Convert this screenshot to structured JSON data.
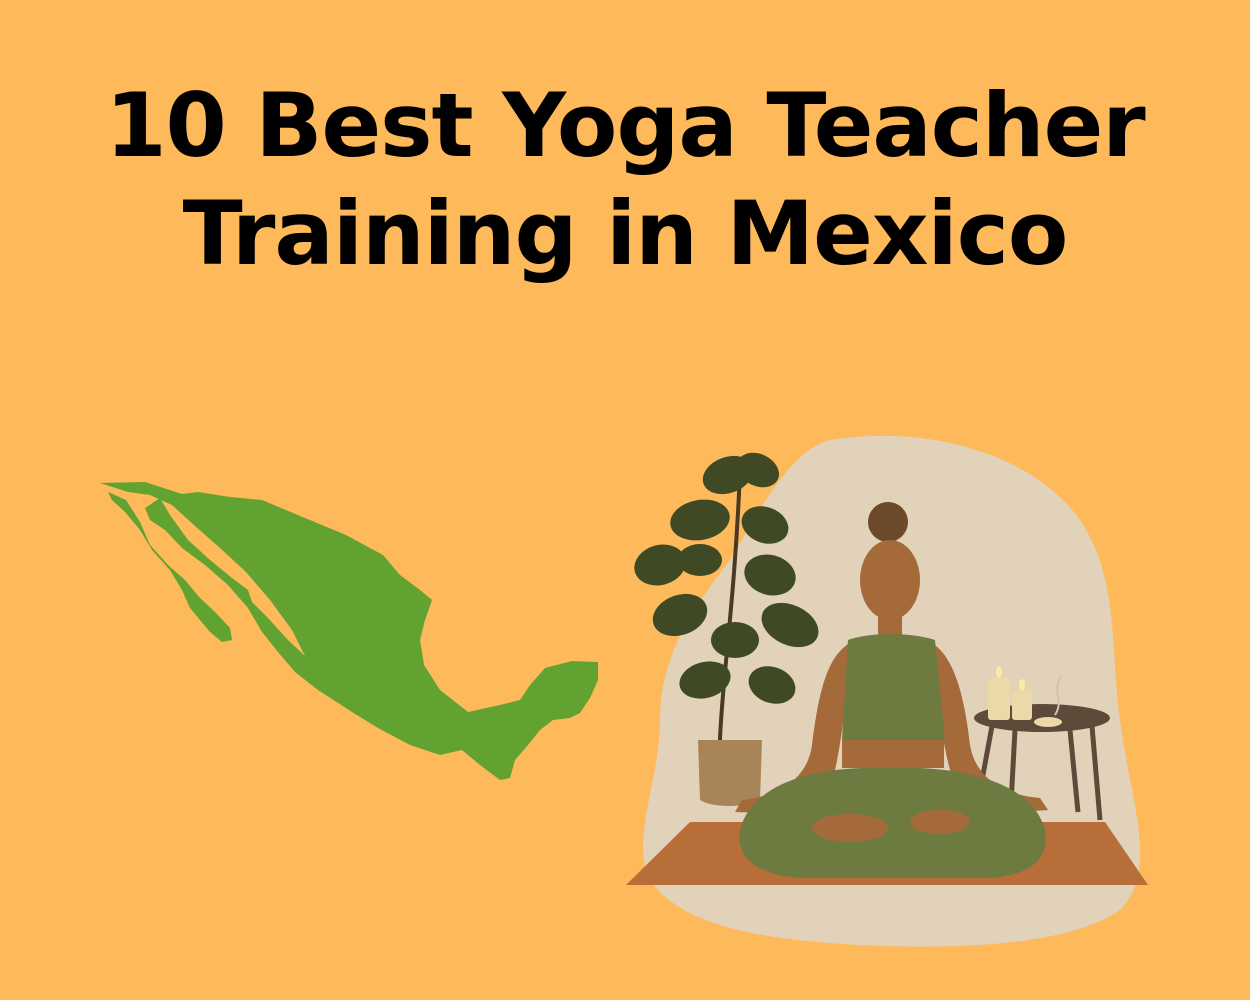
{
  "title": {
    "line1": "10 Best Yoga Teacher",
    "line2": "Training in Mexico"
  },
  "colors": {
    "background": "#FDB95A",
    "map": "#62A231",
    "blob": "#E2D2BA",
    "mat": "#B86E39",
    "skin": "#A56A3A",
    "outfit": "#6E7B40",
    "plant": "#3F4A24",
    "pot": "#A88458",
    "table": "#5E4A3A",
    "candle": "#EBD9A8"
  },
  "icons": {
    "map": "mexico-map-icon",
    "illustration": "meditating-woman-illustration"
  }
}
